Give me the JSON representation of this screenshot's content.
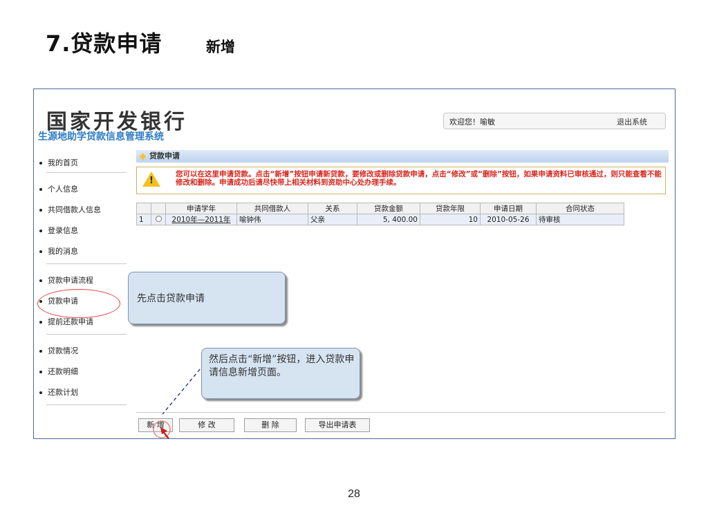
{
  "slide": {
    "title": "7.贷款申请",
    "subtitle": "新增",
    "page_number": "28"
  },
  "app": {
    "logo_text": "国家开发银行",
    "logo_subtitle": "生源地助学贷款信息管理系统",
    "welcome": "欢迎您！喻敏",
    "logout": "退出系统"
  },
  "sidebar": {
    "items": [
      {
        "label": "我的首页"
      },
      {
        "label": "个人信息"
      },
      {
        "label": "共同借款人信息"
      },
      {
        "label": "登录信息"
      },
      {
        "label": "我的消息"
      },
      {
        "label": "贷款申请流程"
      },
      {
        "label": "贷款申请"
      },
      {
        "label": "提前还款申请"
      },
      {
        "label": "贷款情况"
      },
      {
        "label": "还款明细"
      },
      {
        "label": "还款计划"
      }
    ]
  },
  "breadcrumb": {
    "label": "贷款申请"
  },
  "notice": {
    "text": "您可以在这里申请贷款。点击“新增”按钮申请新贷款，要修改或删除贷款申请，点击“修改”或“删除”按钮，如果申请资料已审核通过，则只能查看不能修改和删除。申请成功后请尽快带上相关材料到资助中心处办理手续。"
  },
  "table": {
    "headers": [
      "",
      "",
      "申请学年",
      "共同借款人",
      "关系",
      "贷款金额",
      "贷款年限",
      "申请日期",
      "合同状态"
    ],
    "rows": [
      {
        "index": "1",
        "year": "2010年—2011年",
        "co_borrower": "喻钟伟",
        "relation": "父亲",
        "amount": "5, 400.00",
        "term": "10",
        "date": "2010-05-26",
        "status": "待审核"
      }
    ]
  },
  "buttons": {
    "add": "新 增",
    "edit": "修 改",
    "delete": "删 除",
    "export": "导出申请表"
  },
  "callouts": {
    "first": "先点击贷款申请",
    "second": "然后点击“新增”按钮，进入贷款申请信息新增页面。"
  },
  "colors": {
    "frame_border": "#4a6a96",
    "notice_red": "#d9261c",
    "callout_bg": "#d6e3f1",
    "highlight": "#e24040"
  }
}
